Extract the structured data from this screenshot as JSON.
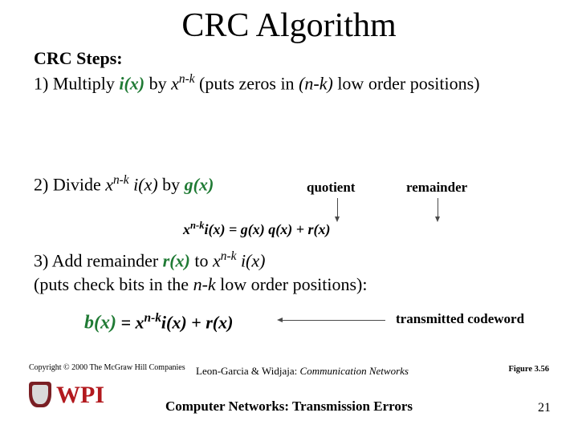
{
  "title": "CRC Algorithm",
  "steps_heading": "CRC Steps:",
  "step1_prefix": "1)  Multiply ",
  "ix": "i(x)",
  "by": " by ",
  "x": "x",
  "nk": "n-k",
  "step1_suffix": " (puts zeros in ",
  "nk_ital": "(n-k)",
  "step1_end": " low order positions)",
  "step2_prefix": "2)  Divide ",
  "ixplain": " i(x)",
  "step2_by": " by ",
  "gx": "g(x)",
  "quotient": "quotient",
  "remainder": "remainder",
  "center_eq": "x",
  "center_eq2": "i(x) = g(x) q(x) + r(x)",
  "step3_a": "3)  Add remainder ",
  "rx": "r(x)",
  "step3_b": " to ",
  "step3_c": " i(x)",
  "step3_d": "(puts check bits in the ",
  "step3_e": "n-k",
  "step3_f": " low order positions):",
  "bx": "b(x)",
  "bx_tail": "i(x) + r(x)",
  "eq_sign": " = ",
  "tx_word": "transmitted codeword",
  "copyright": "Copyright © 2000 The McGraw Hill Companies",
  "cite_a": "Leon-Garcia & Widjaja:",
  "cite_b": "  Communication Networks",
  "fig": "Figure 3.56",
  "bottom": "Computer Networks: Transmission Errors",
  "page": "21",
  "wpi": "WPI"
}
